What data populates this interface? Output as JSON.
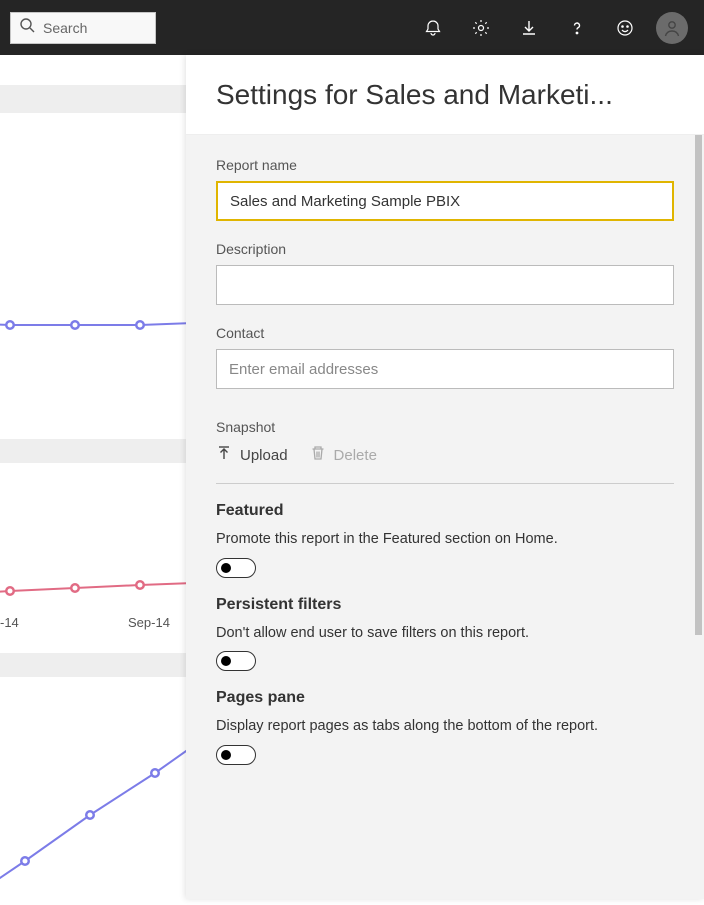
{
  "header": {
    "search_placeholder": "Search"
  },
  "background": {
    "axis_label_1": "-14",
    "axis_label_2": "Sep-14"
  },
  "panel": {
    "title": "Settings for Sales and Marketi...",
    "report_name_label": "Report name",
    "report_name_value": "Sales and Marketing Sample PBIX",
    "description_label": "Description",
    "description_value": "",
    "contact_label": "Contact",
    "contact_placeholder": "Enter email addresses",
    "snapshot_label": "Snapshot",
    "snapshot_upload": "Upload",
    "snapshot_delete": "Delete",
    "featured_heading": "Featured",
    "featured_desc": "Promote this report in the Featured section on Home.",
    "persistent_heading": "Persistent filters",
    "persistent_desc": "Don't allow end user to save filters on this report.",
    "pages_heading": "Pages pane",
    "pages_desc": "Display report pages as tabs along the bottom of the report."
  }
}
